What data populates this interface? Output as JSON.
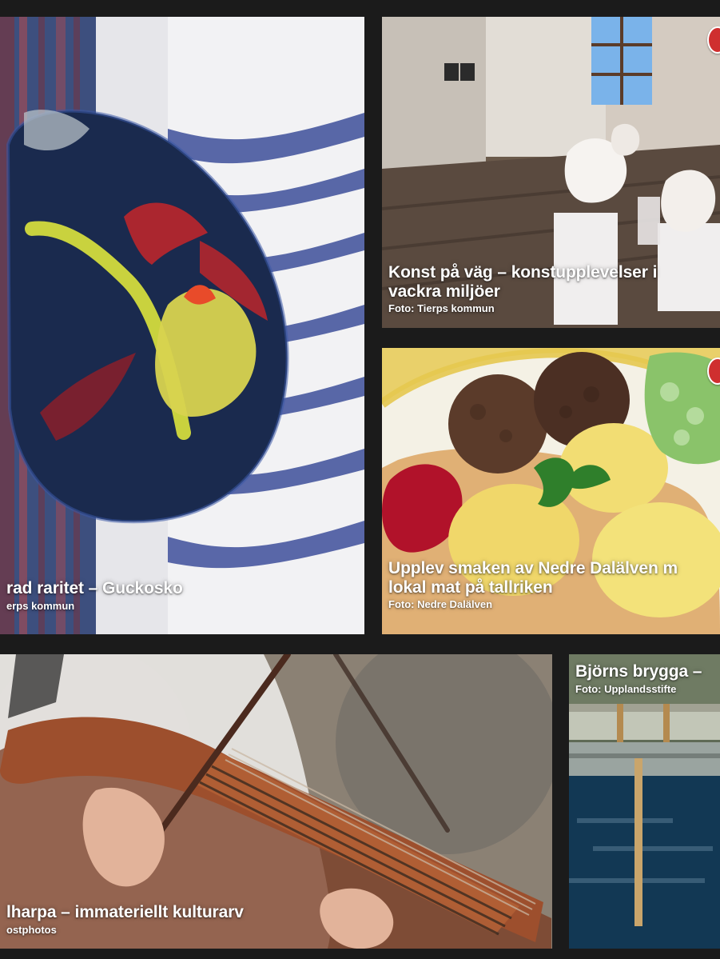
{
  "tiles": {
    "guckosko": {
      "title": "rad raritet – Guckosko",
      "credit": "erps kommun"
    },
    "konst": {
      "title": "Konst på väg – konstupplevelser i\nvackra miljöer",
      "credit": "Foto:  Tierps kommun"
    },
    "mat": {
      "title": "Upplev smaken av Nedre Dalälven m\nlokal mat på tallriken",
      "credit": "Foto: Nedre Dalälven"
    },
    "nyckelharpa": {
      "title": "lharpa – immateriellt kulturarv",
      "credit": "ostphotos"
    },
    "brygga": {
      "title": "Björns brygga –",
      "credit": "Foto: Upplandsstifte"
    }
  },
  "icons": {
    "marker_color": "#cf2f2f"
  }
}
